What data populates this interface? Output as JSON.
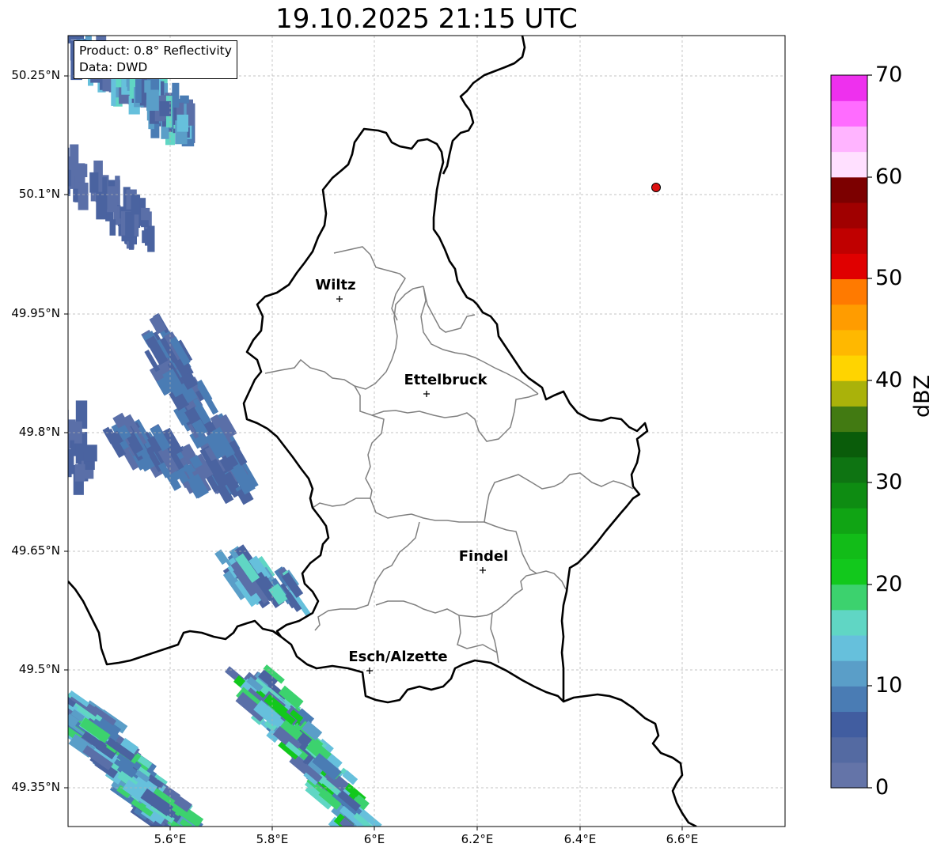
{
  "title": "19.10.2025 21:15 UTC",
  "info": {
    "product": "Product: 0.8° Reflectivity",
    "data": "Data: DWD"
  },
  "y_ticks": [
    "50.25°N",
    "50.1°N",
    "49.95°N",
    "49.8°N",
    "49.65°N",
    "49.5°N",
    "49.35°N"
  ],
  "x_ticks": [
    "5.6°E",
    "5.8°E",
    "6°E",
    "6.2°E",
    "6.4°E",
    "6.6°E"
  ],
  "cities": [
    {
      "name": "Wiltz"
    },
    {
      "name": "Ettelbruck"
    },
    {
      "name": "Findel"
    },
    {
      "name": "Esch/Alzette"
    }
  ],
  "marker": {
    "name": "red-dot-marker",
    "color": "#dd1111"
  },
  "colorbar": {
    "unit": "dBZ",
    "tick_labels": [
      "0",
      "10",
      "20",
      "30",
      "40",
      "50",
      "60",
      "70"
    ],
    "colors": [
      "#6474a8",
      "#546aa2",
      "#415da0",
      "#4a7cb4",
      "#5a9ec8",
      "#66c0dc",
      "#60d6c4",
      "#3cd26e",
      "#12c81c",
      "#12bc18",
      "#10a414",
      "#0e8c12",
      "#0e7412",
      "#0a5c0a",
      "#427a12",
      "#aab20a",
      "#ffd400",
      "#ffb800",
      "#ff9c00",
      "#ff7a00",
      "#e00000",
      "#c00000",
      "#a00000",
      "#7c0000",
      "#ffe0ff",
      "#ffb4ff",
      "#ff6cff",
      "#ee30ee"
    ]
  },
  "colors": {
    "country_border": "#000000",
    "canton_border": "#808080",
    "grid": "#b0b0b0"
  }
}
